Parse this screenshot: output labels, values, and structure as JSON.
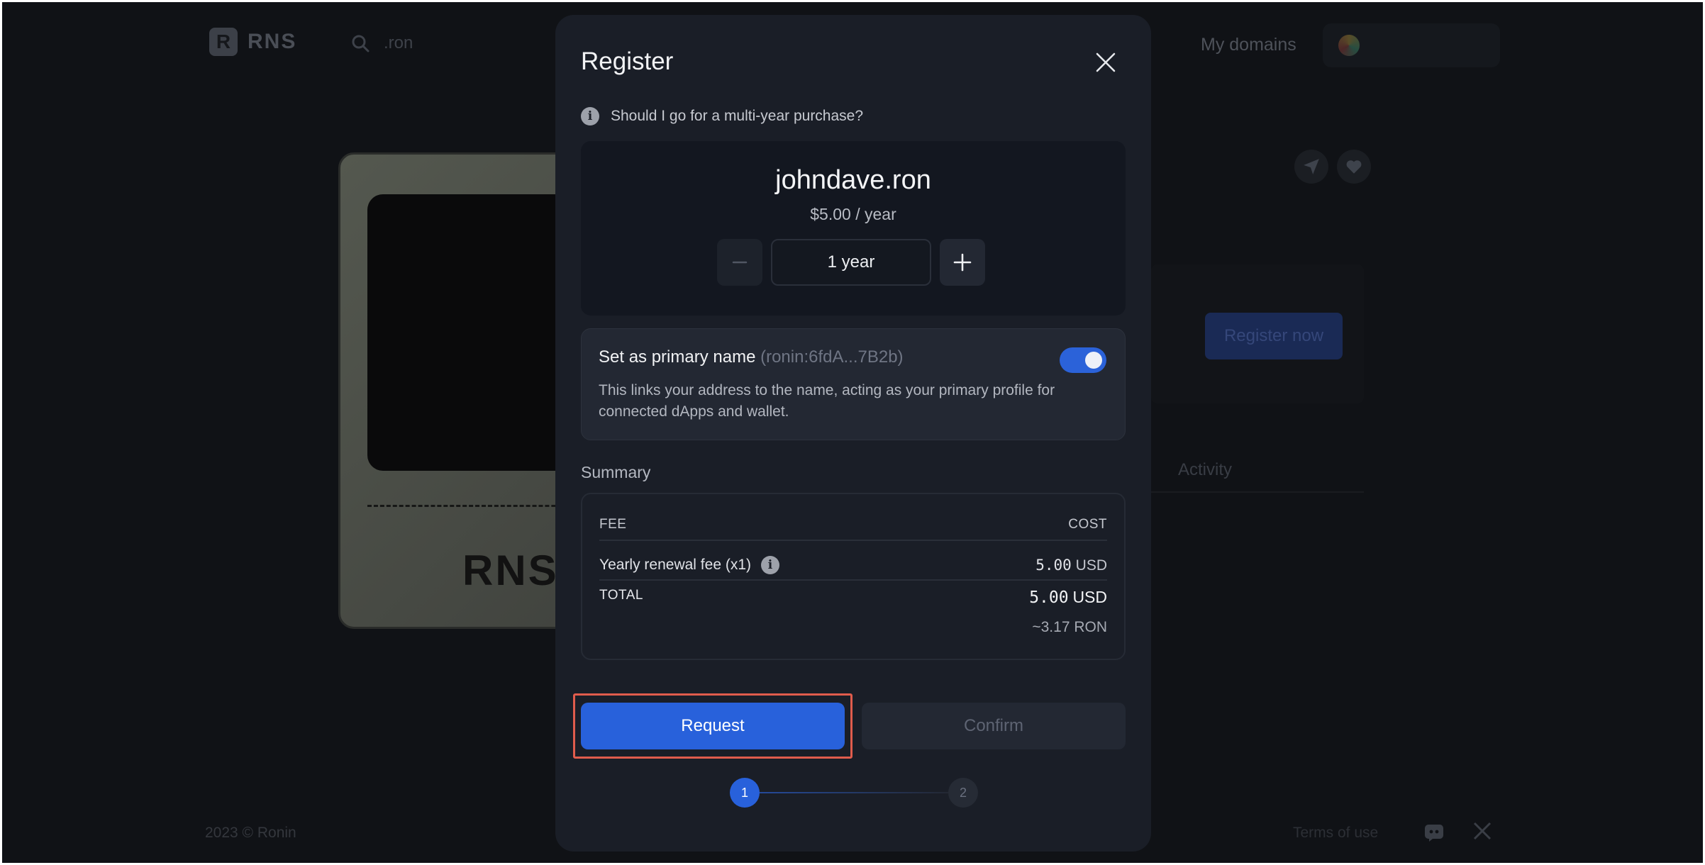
{
  "background": {
    "logo_mark": "R",
    "logo_text": "RNS",
    "search_placeholder": ".ron",
    "nav_my_domains": "My domains",
    "card_label": "RNS",
    "register_now": "Register now",
    "activity_tab": "Activity",
    "footer_copyright": "2023 © Ronin",
    "footer_terms": "Terms of use"
  },
  "modal": {
    "title": "Register",
    "hint": "Should I go for a multi-year purchase?",
    "domain": {
      "name": "johndave.ron",
      "price": "$5.00 / year",
      "duration": "1 year"
    },
    "primary": {
      "title": "Set as primary name",
      "address": "(ronin:6fdA...7B2b)",
      "description": "This links your address to the name, acting as your primary profile for connected dApps and wallet.",
      "enabled": true
    },
    "summary": {
      "label": "Summary",
      "fee_header": "FEE",
      "cost_header": "COST",
      "rows": [
        {
          "label": "Yearly renewal fee (x1)",
          "amount": "5.00",
          "unit": "USD"
        }
      ],
      "total_label": "TOTAL",
      "total_amount": "5.00",
      "total_unit": "USD",
      "total_ron": "~3.17 RON"
    },
    "actions": {
      "request": "Request",
      "confirm": "Confirm"
    },
    "steps": [
      "1",
      "2"
    ]
  },
  "colors": {
    "accent": "#2861db",
    "modal_bg": "#1a1e27",
    "highlight": "#e05c4c"
  }
}
